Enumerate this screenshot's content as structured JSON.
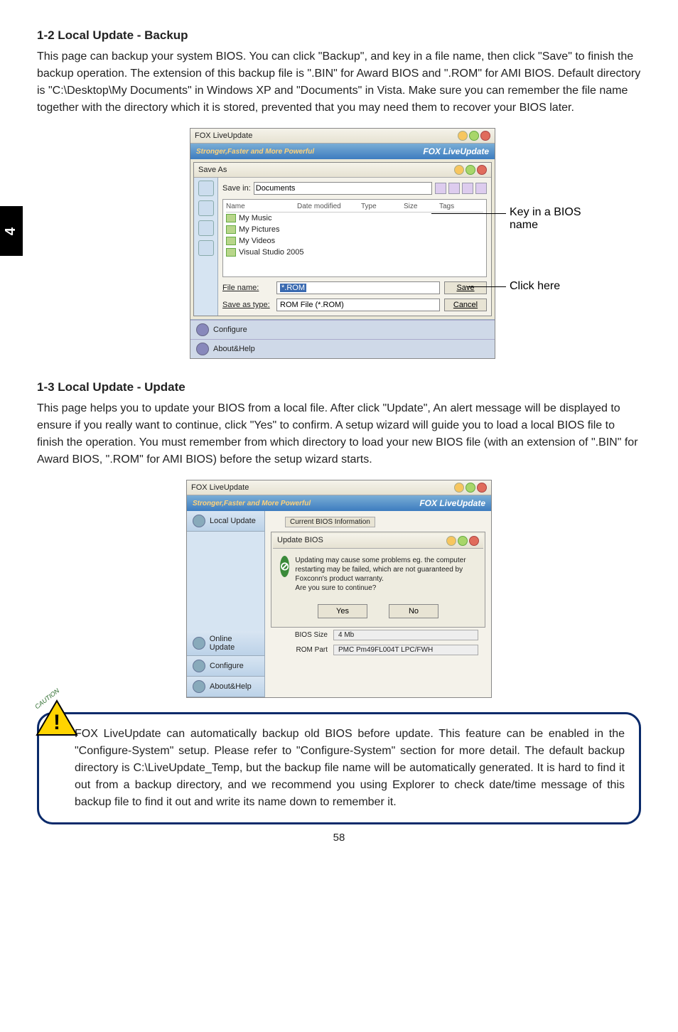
{
  "sidebar_tab": "4",
  "section1": {
    "heading": "1-2 Local Update - Backup",
    "body": "This page can backup your system BIOS. You can click \"Backup\", and key in a file name, then click \"Save\" to finish the backup operation. The extension of this backup file is \".BIN\" for Award BIOS and \".ROM\" for AMI BIOS. Default directory is \"C:\\Desktop\\My Documents\" in Windows XP and \"Documents\" in Vista. Make sure you can remember the file name together with the directory which it is stored, prevented that you may need them to recover your BIOS later."
  },
  "shot1": {
    "app_title": "FOX LiveUpdate",
    "banner_left": "Stronger,Faster and More Powerful",
    "banner_right": "FOX LiveUpdate",
    "saveas_title": "Save As",
    "savein_label": "Save in:",
    "savein_value": "Documents",
    "col1": "Name",
    "col2": "Date modified",
    "col3": "Type",
    "col4": "Size",
    "col5": "Tags",
    "items": [
      "My Music",
      "My Pictures",
      "My Videos",
      "Visual Studio 2005"
    ],
    "filename_label": "File name:",
    "filename_value": "*.ROM",
    "savetype_label": "Save as type:",
    "savetype_value": "ROM File (*.ROM)",
    "save_btn": "Save",
    "cancel_btn": "Cancel",
    "configure": "Configure",
    "about": "About&Help"
  },
  "anno1": "Key in a BIOS name",
  "anno2": "Click here",
  "section2": {
    "heading": "1-3 Local Update - Update",
    "body": "This page helps you to update your BIOS from a local file. After click \"Update\", An alert message will be displayed to ensure if you really want to continue, click \"Yes\" to confirm. A setup wizard will guide you to load a local BIOS file to finish the operation. You must remember from which directory to load your new BIOS file (with an extension of \".BIN\" for Award BIOS, \".ROM\" for AMI BIOS) before the setup wizard starts."
  },
  "shot2": {
    "app_title": "FOX LiveUpdate",
    "banner_left": "Stronger,Faster and More Powerful",
    "banner_right": "FOX LiveUpdate",
    "local_update": "Local Update",
    "update_bios_title": "Update BIOS",
    "current_bios": "Current BIOS Information",
    "warn_text": "Updating may cause some problems eg. the computer restarting may be failed, which are not guaranteed by Foxconn's product warranty.\nAre you sure to continue?",
    "yes": "Yes",
    "no": "No",
    "bios_size_label": "BIOS Size",
    "bios_size_val": "4 Mb",
    "rom_part_label": "ROM Part",
    "rom_part_val": "PMC Pm49FL004T LPC/FWH",
    "online_update": "Online Update",
    "configure": "Configure",
    "about": "About&Help"
  },
  "caution": {
    "label": "CAUTION",
    "mark": "!",
    "text": "FOX LiveUpdate can automatically backup old BIOS before update. This feature can be enabled in the \"Configure-System\" setup. Please refer to \"Configure-System\" section for more detail. The default backup directory is C:\\LiveUpdate_Temp, but the backup file name will be automatically generated. It is hard to find it out from a backup directory, and we recommend you using Explorer to check date/time message of this backup file to find it out and write its name down to remember it."
  },
  "page_number": "58"
}
